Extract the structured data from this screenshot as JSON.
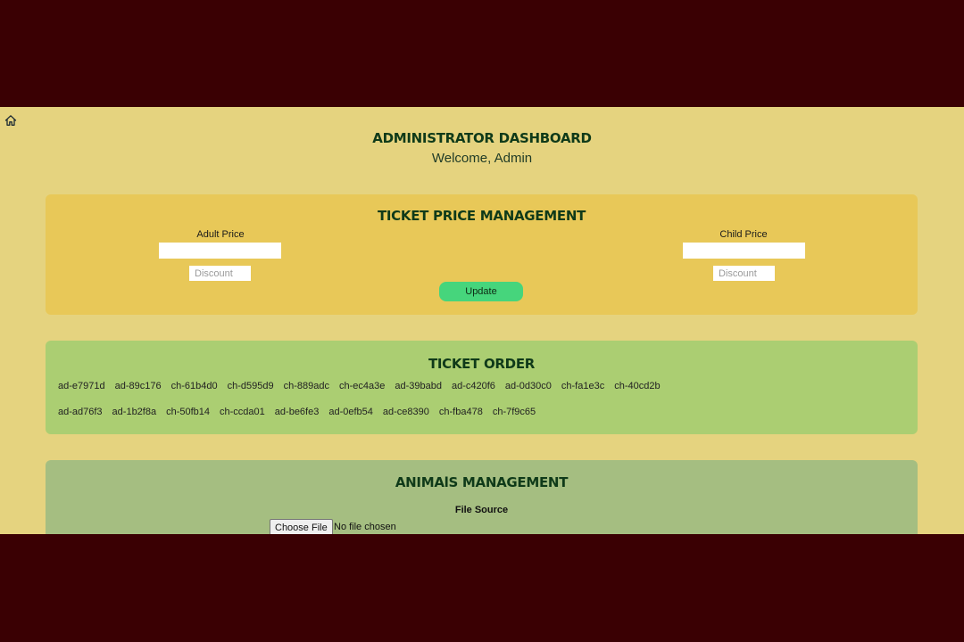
{
  "header": {
    "title": "ADMINISTRATOR DASHBOARD",
    "welcome": "Welcome, Admin"
  },
  "ticket_price": {
    "title": "TICKET PRICE MANAGEMENT",
    "adult_label": "Adult Price",
    "adult_value": "",
    "adult_discount_placeholder": "Discount",
    "child_label": "Child Price",
    "child_value": "",
    "child_discount_placeholder": "Discount",
    "update_label": "Update"
  },
  "ticket_order": {
    "title": "TICKET ORDER",
    "row1": [
      "ad-e7971d",
      "ad-89c176",
      "ch-61b4d0",
      "ch-d595d9",
      "ch-889adc",
      "ch-ec4a3e",
      "ad-39babd",
      "ad-c420f6",
      "ad-0d30c0",
      "ch-fa1e3c",
      "ch-40cd2b"
    ],
    "row2": [
      "ad-ad76f3",
      "ad-1b2f8a",
      "ch-50fb14",
      "ch-ccda01",
      "ad-be6fe3",
      "ad-0efb54",
      "ad-ce8390",
      "ch-fba478",
      "ch-7f9c65"
    ]
  },
  "animals": {
    "title": "ANIMAlS MANAGEMENT",
    "file_label": "File Source",
    "choose_file": "Choose File",
    "file_status": "No file chosen"
  },
  "colors": {
    "page_bg": "#e5d37f",
    "letterbox": "#3a0003",
    "price_panel": "#e8c858",
    "order_panel": "#abce72",
    "animals_panel": "#a5be81",
    "heading": "#0f3a19",
    "update_button": "#46d57c"
  },
  "icons": {
    "home": "home-icon"
  }
}
